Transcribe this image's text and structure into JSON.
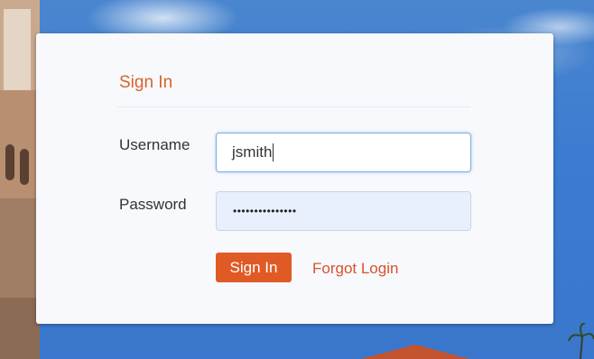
{
  "login": {
    "title": "Sign In",
    "username_label": "Username",
    "username_value": "jsmith",
    "password_label": "Password",
    "password_masked": "•••••••••••••••",
    "submit_label": "Sign In",
    "forgot_label": "Forgot Login"
  },
  "colors": {
    "accent": "#e05a26",
    "title": "#d9622b",
    "link": "#d9532b",
    "panel_bg": "#f7f9fc",
    "focus_border": "#7eaee8",
    "autofill_bg": "#e8f0fe"
  },
  "icons": {
    "background": "campus-photo"
  }
}
